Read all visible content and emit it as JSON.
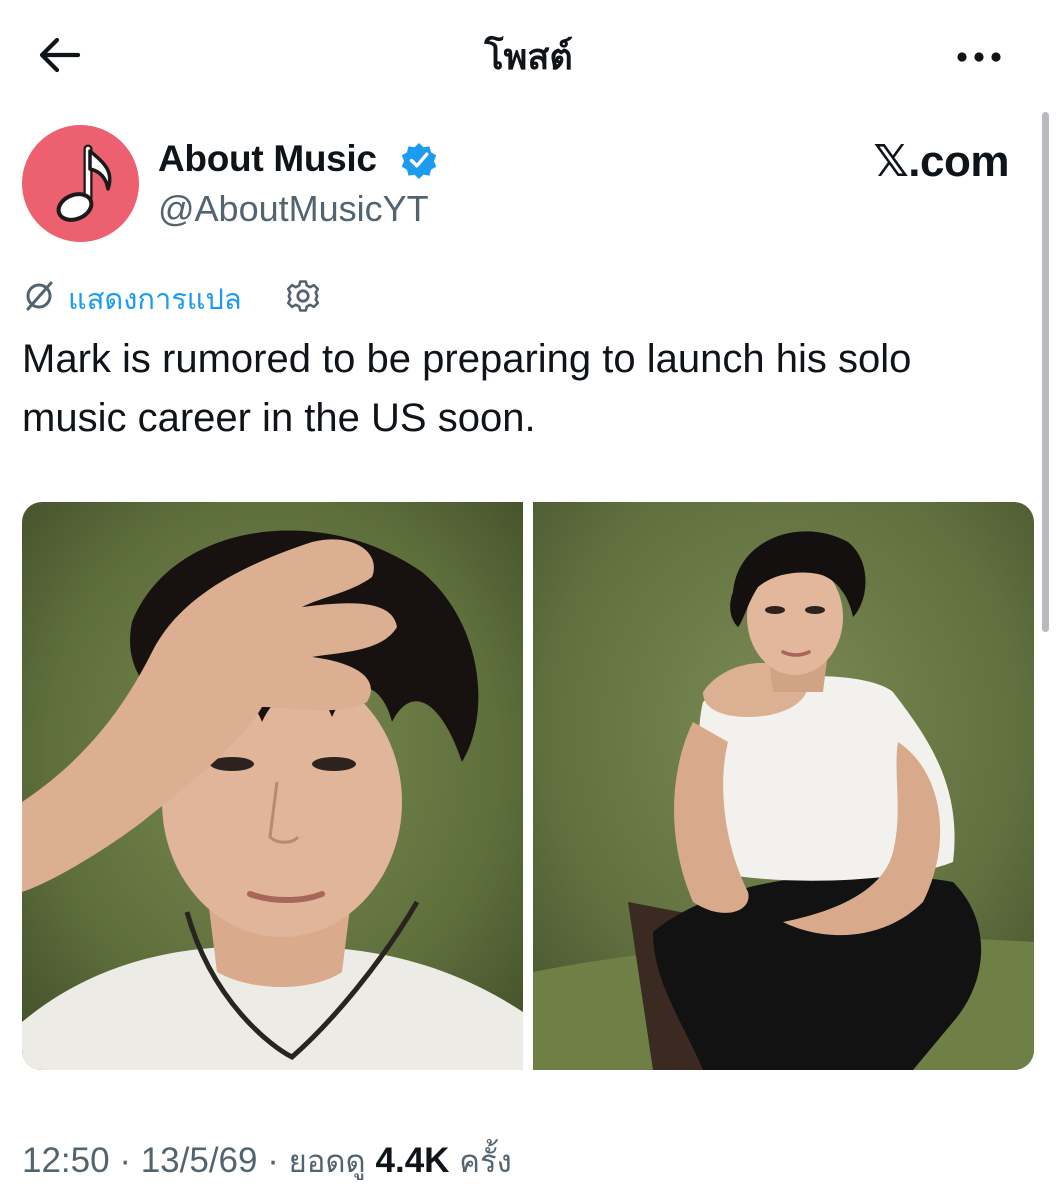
{
  "header": {
    "title": "โพสต์",
    "back_icon": "arrow-left-icon",
    "more_icon": "more-horizontal-icon"
  },
  "author": {
    "display_name": "About Music",
    "handle": "@AboutMusicYT",
    "verified": true,
    "avatar_icon": "music-note-icon",
    "avatar_color": "#ec6070",
    "verified_color": "#1d9bf0"
  },
  "source_label": "𝕏.com",
  "translation": {
    "link_label": "แสดงการแปล",
    "icon": "translate-icon",
    "settings_icon": "gear-icon",
    "link_color": "#1d9bf0"
  },
  "tweet": {
    "text": "Mark is rumored to be preparing to launch his solo music career in the US soon."
  },
  "media": [
    {
      "icon": "photo-closeup"
    },
    {
      "icon": "photo-fullbody"
    }
  ],
  "meta": {
    "time": "12:50",
    "sep1": " · ",
    "date": "13/5/69",
    "sep2": " · ",
    "views_label": "ยอดดู ",
    "views_count": "4.4K",
    "views_suffix": " ครั้ง"
  },
  "colors": {
    "text_primary": "#0f1419",
    "text_secondary": "#536471",
    "accent": "#1d9bf0"
  }
}
